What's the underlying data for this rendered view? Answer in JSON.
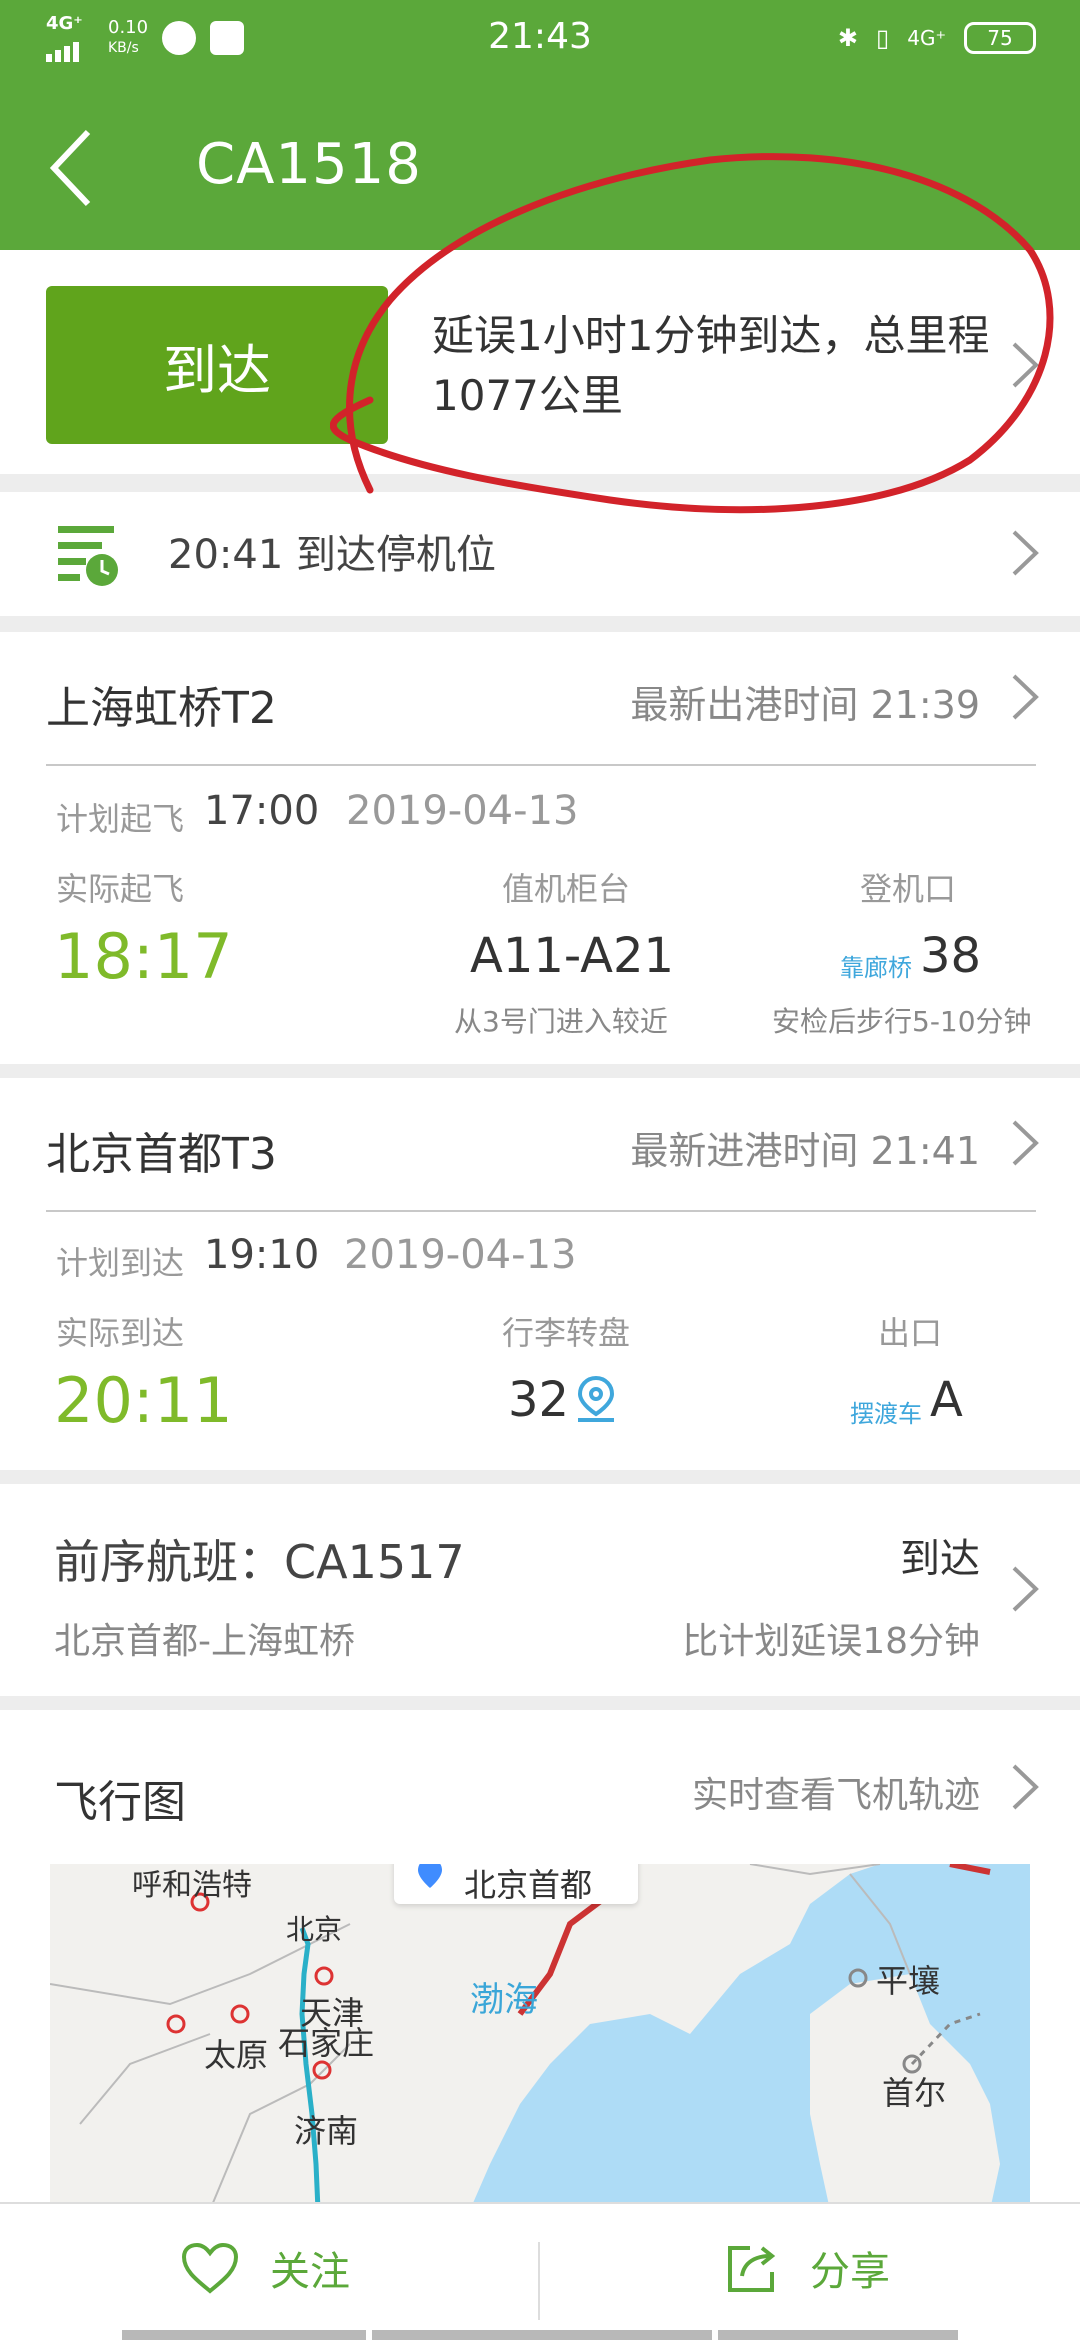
{
  "status_bar": {
    "network": "4G⁺",
    "speed_value": "0.10",
    "speed_unit": "KB/s",
    "time": "21:43",
    "network_right": "4G⁺",
    "battery": "75"
  },
  "header": {
    "title": "CA1518"
  },
  "status": {
    "button": "到达",
    "summary": "延误1小时1分钟到达，总里程1077公里"
  },
  "parking": {
    "text": "20:41 到达停机位"
  },
  "departure": {
    "airport": "上海虹桥T2",
    "latest_label": "最新出港时间 21:39",
    "planned_label": "计划起飞",
    "planned_time": "17:00",
    "planned_date": "2019-04-13",
    "actual_label": "实际起飞",
    "actual_time": "18:17",
    "checkin_label": "值机柜台",
    "checkin_value": "A11-A21",
    "checkin_note": "从3号门进入较近",
    "gate_label": "登机口",
    "gate_tag": "靠廊桥",
    "gate_value": "38",
    "gate_note": "安检后步行5-10分钟"
  },
  "arrival": {
    "airport": "北京首都T3",
    "latest_label": "最新进港时间 21:41",
    "planned_label": "计划到达",
    "planned_time": "19:10",
    "planned_date": "2019-04-13",
    "actual_label": "实际到达",
    "actual_time": "20:11",
    "baggage_label": "行李转盘",
    "baggage_value": "32",
    "exit_label": "出口",
    "exit_tag": "摆渡车",
    "exit_value": "A"
  },
  "previous": {
    "title": "前序航班：CA1517",
    "status": "到达",
    "route": "北京首都-上海虹桥",
    "delay": "比计划延误18分钟"
  },
  "flight_map": {
    "title": "飞行图",
    "link": "实时查看飞机轨迹",
    "popup": "北京首都",
    "cities": [
      "呼和浩特",
      "北京",
      "天津",
      "渤海",
      "平壤",
      "太原",
      "石家庄",
      "首尔",
      "济南"
    ]
  },
  "footer": {
    "follow": "关注",
    "share": "分享"
  },
  "colors": {
    "brand_green": "#5ba83a",
    "status_green": "#60a41c",
    "time_green": "#7fba2a",
    "tag_blue": "#3fa7dc",
    "annotation_red": "#d2232a"
  }
}
